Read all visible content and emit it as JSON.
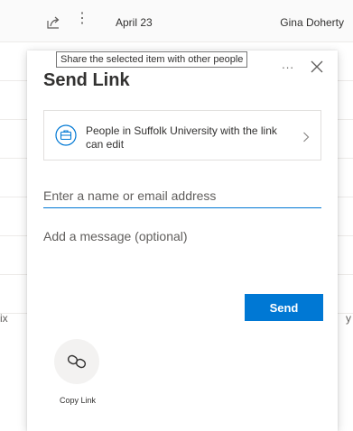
{
  "background": {
    "date": "April 23",
    "user": "Gina Doherty",
    "cut_left": "ix",
    "cut_right": "y"
  },
  "tooltip": {
    "text": "Share the selected item with other people"
  },
  "panel": {
    "title": "Send Link",
    "more": "...",
    "permission_text": "People in Suffolk University with the link can edit",
    "name_placeholder": "Enter a name or email address",
    "message_placeholder": "Add a message (optional)",
    "send_label": "Send",
    "copy_link_label": "Copy Link"
  },
  "colors": {
    "accent": "#0078d4",
    "text": "#323130",
    "muted": "#605e5c"
  },
  "icons": {
    "share": "share-icon",
    "more": "more-icon",
    "close": "close-icon",
    "briefcase": "briefcase-icon",
    "chevron": "chevron-right-icon",
    "link": "link-icon"
  }
}
